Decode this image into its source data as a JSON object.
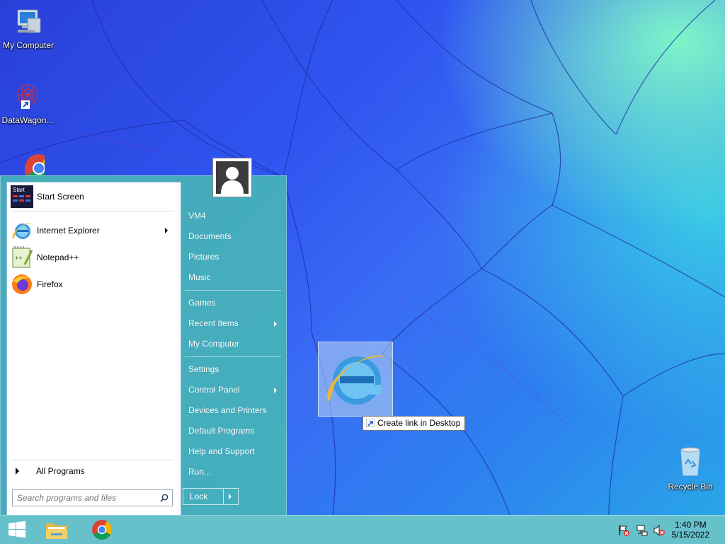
{
  "desktop": {
    "icons": [
      {
        "label": "My Computer"
      },
      {
        "label": "DataWagon..."
      },
      {
        "label": ""
      },
      {
        "label": "Recycle Bin"
      }
    ]
  },
  "start_menu": {
    "pinned": [
      {
        "label": "Start Screen",
        "icon": "start-screen-icon",
        "icon_text": "Start"
      },
      {
        "label": "Internet Explorer",
        "icon": "internet-explorer-icon",
        "has_submenu": true
      },
      {
        "label": "Notepad++",
        "icon": "notepadpp-icon"
      },
      {
        "label": "Firefox",
        "icon": "firefox-icon"
      }
    ],
    "all_programs": "All Programs",
    "search_placeholder": "Search programs and files",
    "right": {
      "user": "VM4",
      "items": [
        {
          "label": "Documents"
        },
        {
          "label": "Pictures"
        },
        {
          "label": "Music"
        },
        {
          "label": "Games"
        },
        {
          "label": "Recent Items",
          "has_submenu": true
        },
        {
          "label": "My Computer"
        },
        {
          "label": "Settings"
        },
        {
          "label": "Control Panel",
          "has_submenu": true
        },
        {
          "label": "Devices and Printers"
        },
        {
          "label": "Default Programs"
        },
        {
          "label": "Help and Support"
        },
        {
          "label": "Run..."
        }
      ]
    },
    "power_button": "Lock"
  },
  "drag": {
    "tooltip_prefix": "Create link in ",
    "tooltip_target": "Desktop"
  },
  "taskbar": {
    "clock_time": "1:40 PM",
    "clock_date": "5/15/2022"
  },
  "colors": {
    "taskbar": "#5fbec8",
    "start_menu_bg": "#46b4b9",
    "desktop_blue": "#2f55f0"
  }
}
